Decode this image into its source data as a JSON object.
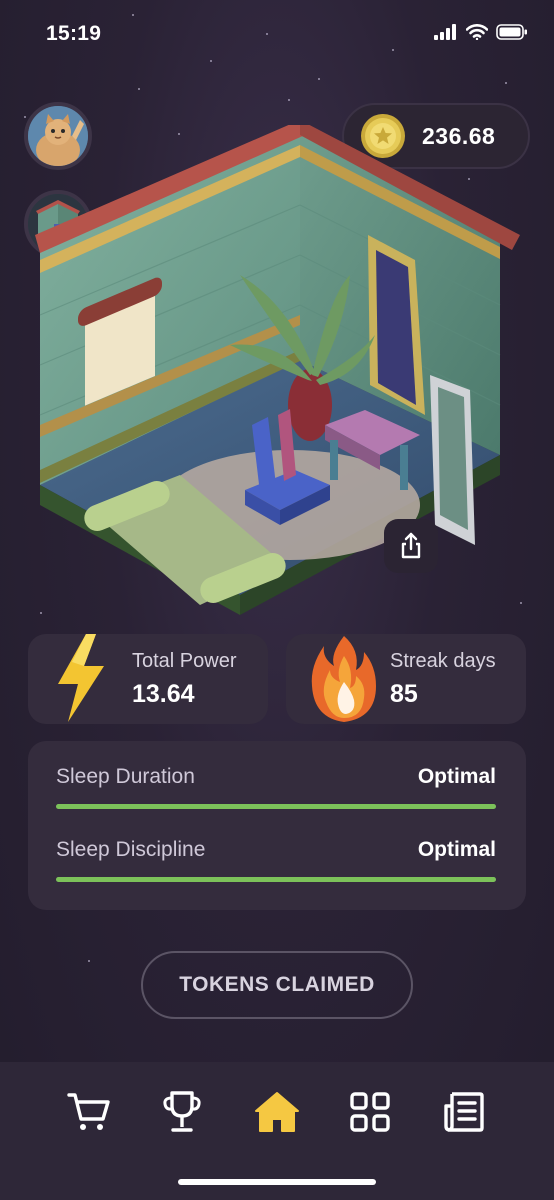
{
  "status_bar": {
    "time": "15:19"
  },
  "balance": {
    "value": "236.68"
  },
  "stats": {
    "power": {
      "label": "Total Power",
      "value": "13.64"
    },
    "streak": {
      "label": "Streak days",
      "value": "85"
    }
  },
  "sleep": {
    "metrics": [
      {
        "label": "Sleep Duration",
        "status": "Optimal",
        "level": 1.0
      },
      {
        "label": "Sleep Discipline",
        "status": "Optimal",
        "level": 1.0
      }
    ]
  },
  "claim_button": {
    "label": "TOKENS CLAIMED"
  },
  "nav": {
    "items": [
      {
        "icon": "cart-icon",
        "active": false
      },
      {
        "icon": "trophy-icon",
        "active": false
      },
      {
        "icon": "home-icon",
        "active": true
      },
      {
        "icon": "grid-icon",
        "active": false
      },
      {
        "icon": "list-icon",
        "active": false
      }
    ],
    "active_color": "#f5c842",
    "inactive_color": "#ffffff"
  },
  "colors": {
    "background": "#2a2334",
    "card": "#342c3d",
    "progress": "#7cc25a"
  }
}
